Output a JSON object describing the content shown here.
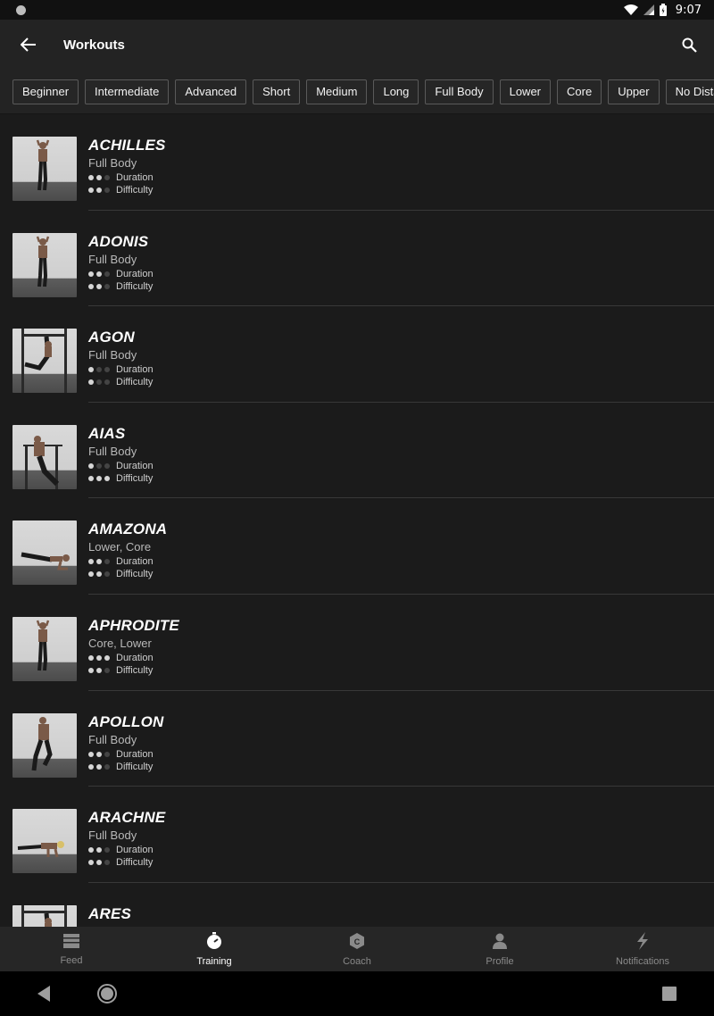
{
  "status_bar": {
    "time": "9:07"
  },
  "header": {
    "title": "Workouts",
    "back_icon": "arrow-left-icon",
    "search_icon": "search-icon"
  },
  "filters": [
    "Beginner",
    "Intermediate",
    "Advanced",
    "Short",
    "Medium",
    "Long",
    "Full Body",
    "Lower",
    "Core",
    "Upper",
    "No Distance"
  ],
  "meter_labels": {
    "duration": "Duration",
    "difficulty": "Difficulty"
  },
  "workouts": [
    {
      "name": "ACHILLES",
      "category": "Full Body",
      "duration": 2,
      "difficulty": 2,
      "thumb": "standing"
    },
    {
      "name": "ADONIS",
      "category": "Full Body",
      "duration": 2,
      "difficulty": 2,
      "thumb": "standing"
    },
    {
      "name": "AGON",
      "category": "Full Body",
      "duration": 1,
      "difficulty": 1,
      "thumb": "bar-hang"
    },
    {
      "name": "AIAS",
      "category": "Full Body",
      "duration": 1,
      "difficulty": 3,
      "thumb": "dip"
    },
    {
      "name": "AMAZONA",
      "category": "Lower, Core",
      "duration": 2,
      "difficulty": 2,
      "thumb": "plank"
    },
    {
      "name": "APHRODITE",
      "category": "Core, Lower",
      "duration": 3,
      "difficulty": 2,
      "thumb": "standing"
    },
    {
      "name": "APOLLON",
      "category": "Full Body",
      "duration": 2,
      "difficulty": 2,
      "thumb": "running"
    },
    {
      "name": "ARACHNE",
      "category": "Full Body",
      "duration": 2,
      "difficulty": 2,
      "thumb": "pushup"
    },
    {
      "name": "ARES",
      "category": "",
      "duration": 0,
      "difficulty": 0,
      "thumb": "bar-hang"
    }
  ],
  "bottom_nav": [
    {
      "label": "Feed",
      "icon": "feed-icon",
      "active": false
    },
    {
      "label": "Training",
      "icon": "stopwatch-icon",
      "active": true
    },
    {
      "label": "Coach",
      "icon": "coach-icon",
      "active": false
    },
    {
      "label": "Profile",
      "icon": "person-icon",
      "active": false
    },
    {
      "label": "Notifications",
      "icon": "lightning-icon",
      "active": false
    }
  ],
  "colors": {
    "background": "#1b1b1b",
    "bar": "#232323",
    "active": "#ffffff",
    "inactive": "#8a8a8a"
  }
}
